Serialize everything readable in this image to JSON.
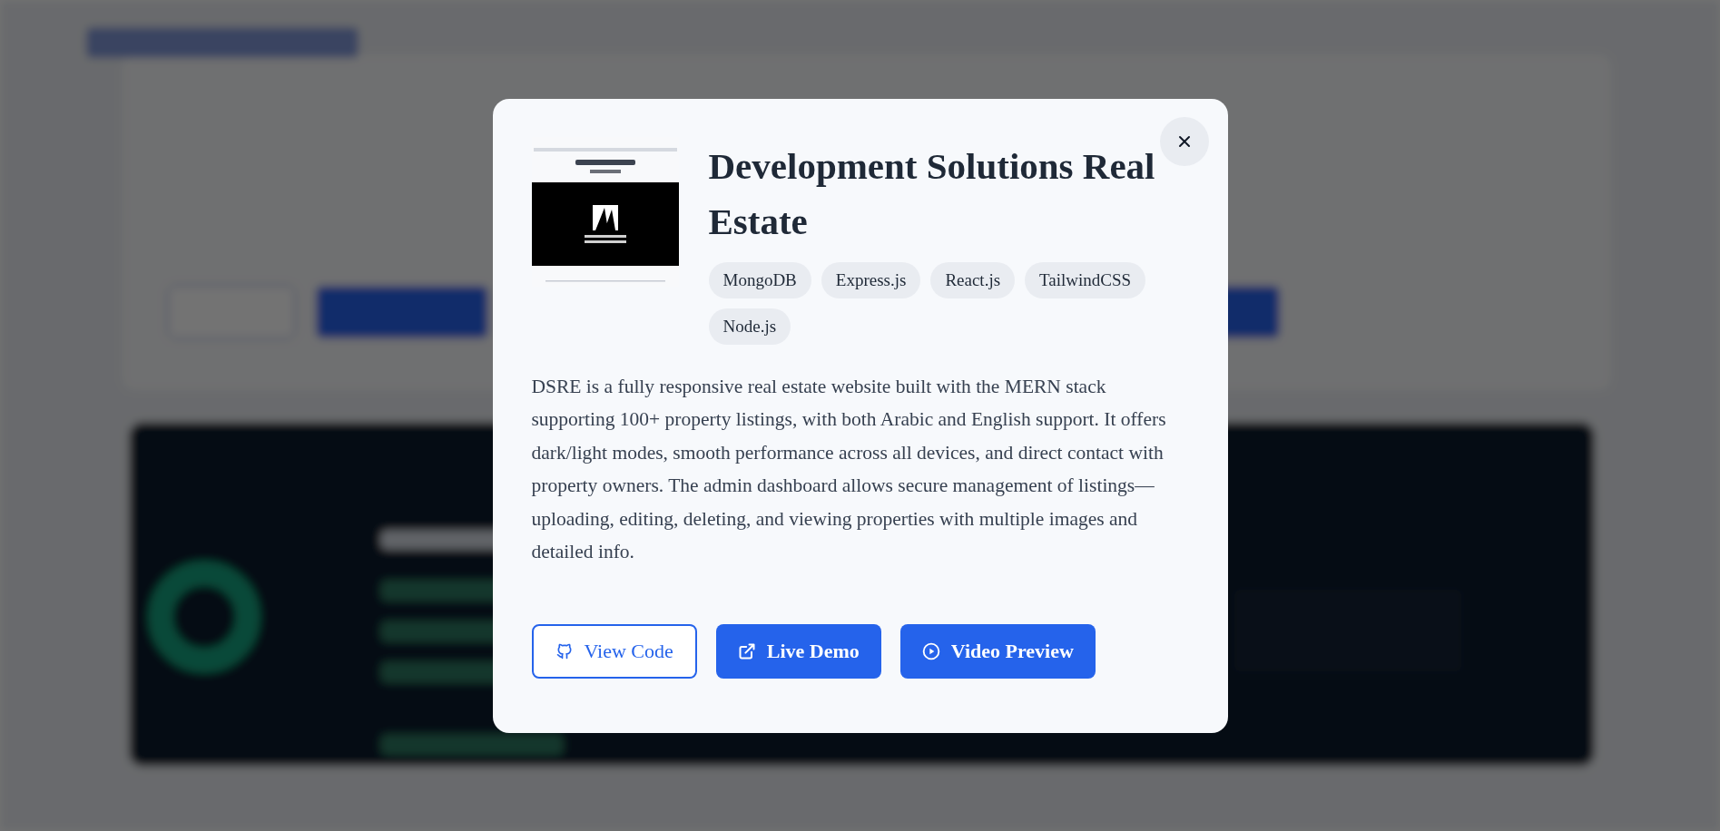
{
  "modal": {
    "title": "Development Solutions Real Estate",
    "tags": [
      "MongoDB",
      "Express.js",
      "React.js",
      "TailwindCSS",
      "Node.js"
    ],
    "description": "DSRE is a fully responsive real estate website built with the MERN stack supporting 100+ property listings, with both Arabic and English support. It offers dark/light modes, smooth performance across all devices, and direct contact with property owners. The admin dashboard allows secure management of listings—uploading, editing, deleting, and viewing properties with multiple images and detailed info.",
    "buttons": [
      {
        "label": "View Code",
        "kind": "code"
      },
      {
        "label": "Live Demo",
        "kind": "demo"
      },
      {
        "label": "Video Preview",
        "kind": "video"
      }
    ]
  }
}
